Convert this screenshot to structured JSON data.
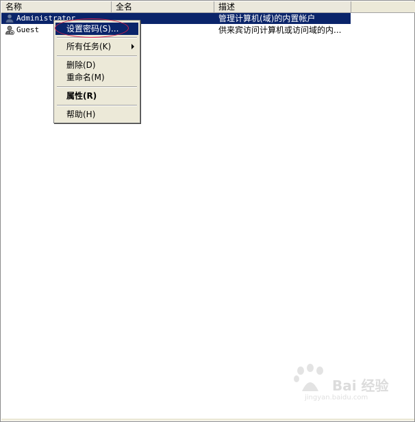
{
  "columns": {
    "name": "名称",
    "full_name": "全名",
    "description": "描述"
  },
  "users": [
    {
      "name": "Administrator",
      "full_name": "",
      "description": "管理计算机(域)的内置帐户",
      "icon": "user-icon",
      "selected": true
    },
    {
      "name": "Guest",
      "full_name": "",
      "description": "供来宾访问计算机或访问域的内...",
      "icon": "disabled-user-icon",
      "selected": false
    }
  ],
  "context_menu": {
    "items": [
      {
        "label": "设置密码(S)...",
        "highlight": true
      },
      {
        "label": "所有任务(K)",
        "submenu": true
      },
      {
        "label": "删除(D)"
      },
      {
        "label": "重命名(M)"
      },
      {
        "label": "属性(R)",
        "bold": true
      },
      {
        "label": "帮助(H)"
      }
    ]
  },
  "watermark": {
    "logo_text": "Bai 经验",
    "url_text": "jingyan.baidu.com"
  },
  "colors": {
    "selection": "#0a246a",
    "annotation": "#d4204a",
    "menu_bg": "#ece9d8"
  }
}
